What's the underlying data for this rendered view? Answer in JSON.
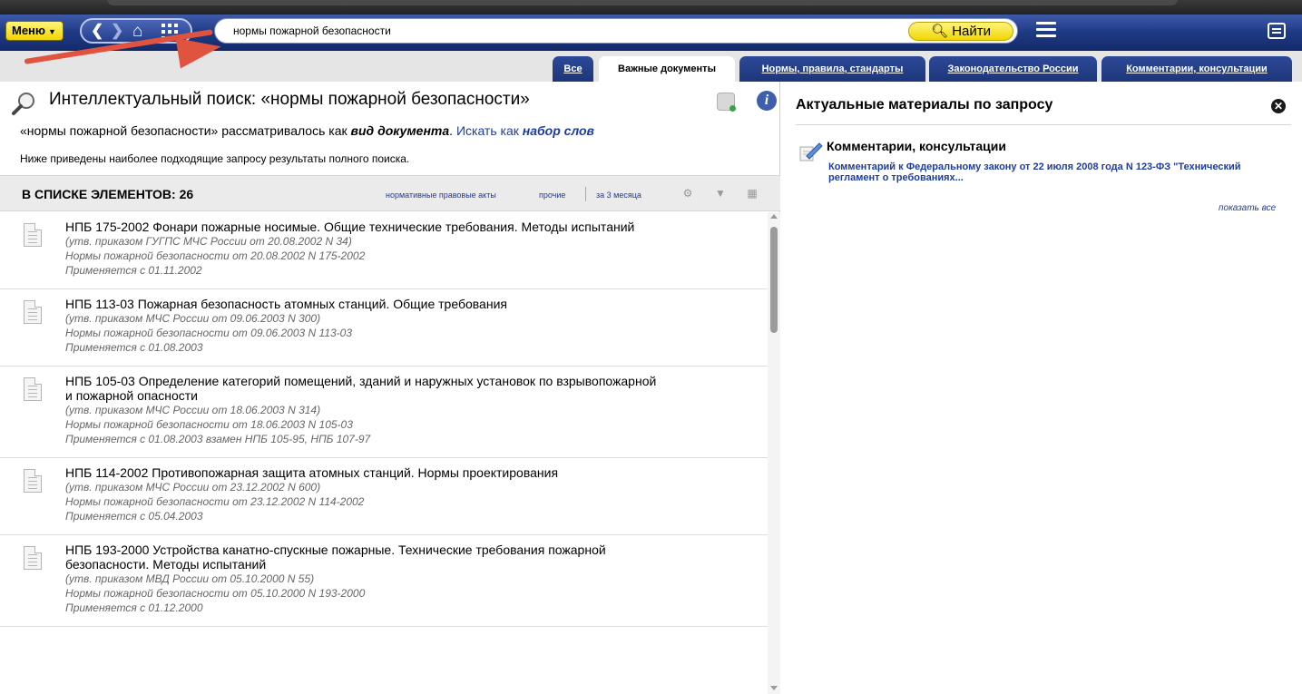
{
  "toolbar": {
    "menu_label": "Меню",
    "search_value": "нормы пожарной безопасности",
    "find_label": "Найти"
  },
  "tabs": [
    {
      "label": "Все"
    },
    {
      "label": "Важные документы"
    },
    {
      "label": "Нормы, правила, стандарты"
    },
    {
      "label": "Законодательство России"
    },
    {
      "label": "Комментарии, консультации"
    }
  ],
  "search": {
    "title": "Интеллектуальный поиск: «нормы пожарной безопасности»",
    "query_prefix": "«нормы пожарной безопасности» рассматривалось как ",
    "query_type": "вид документа",
    "query_alt_prefix": "Искать как ",
    "query_alt": "набор слов",
    "subtitle": "Ниже приведены наиболее подходящие запросу результаты полного поиска."
  },
  "list": {
    "count_label": "В СПИСКЕ ЭЛЕМЕНТОВ: 26",
    "filters": [
      "нормативные правовые акты",
      "прочие",
      "за 3 месяца"
    ],
    "items": [
      {
        "title": "НПБ 175-2002 Фонари пожарные носимые. Общие технические требования. Методы испытаний",
        "meta": [
          "(утв. приказом ГУГПС МЧС России от 20.08.2002 N 34)",
          "Нормы пожарной безопасности от 20.08.2002 N 175-2002",
          "Применяется с 01.11.2002"
        ]
      },
      {
        "title": "НПБ 113-03 Пожарная безопасность атомных станций. Общие требования",
        "meta": [
          "(утв. приказом МЧС России от 09.06.2003 N 300)",
          "Нормы пожарной безопасности от 09.06.2003 N 113-03",
          "Применяется с 01.08.2003"
        ]
      },
      {
        "title": "НПБ 105-03 Определение категорий помещений, зданий и наружных установок по взрывопожарной и пожарной опасности",
        "meta": [
          "(утв. приказом МЧС России от 18.06.2003 N 314)",
          "Нормы пожарной безопасности от 18.06.2003 N 105-03",
          "Применяется с 01.08.2003 взамен НПБ 105-95, НПБ 107-97"
        ]
      },
      {
        "title": "НПБ 114-2002 Противопожарная защита атомных станций. Нормы проектирования",
        "meta": [
          "(утв. приказом МЧС России от 23.12.2002 N 600)",
          "Нормы пожарной безопасности от 23.12.2002 N 114-2002",
          "Применяется с 05.04.2003"
        ]
      },
      {
        "title": "НПБ 193-2000 Устройства канатно-спускные пожарные. Технические требования пожарной безопасности. Методы испытаний",
        "meta": [
          "(утв. приказом МВД России от 05.10.2000 N 55)",
          "Нормы пожарной безопасности от 05.10.2000 N 193-2000",
          "Применяется с 01.12.2000"
        ]
      }
    ]
  },
  "right_panel": {
    "title": "Актуальные материалы по запросу",
    "section_title": "Комментарии, консультации",
    "section_link": "Комментарий к Федеральному закону от 22 июля 2008 года N 123-ФЗ \"Технический регламент о требованиях...",
    "show_all": "показать все"
  },
  "colors": {
    "accent_yellow": "#f2d500",
    "toolbar_blue": "#1f3a85",
    "link_blue": "#1e3d9c",
    "annotation_arrow": "#e0533f"
  }
}
